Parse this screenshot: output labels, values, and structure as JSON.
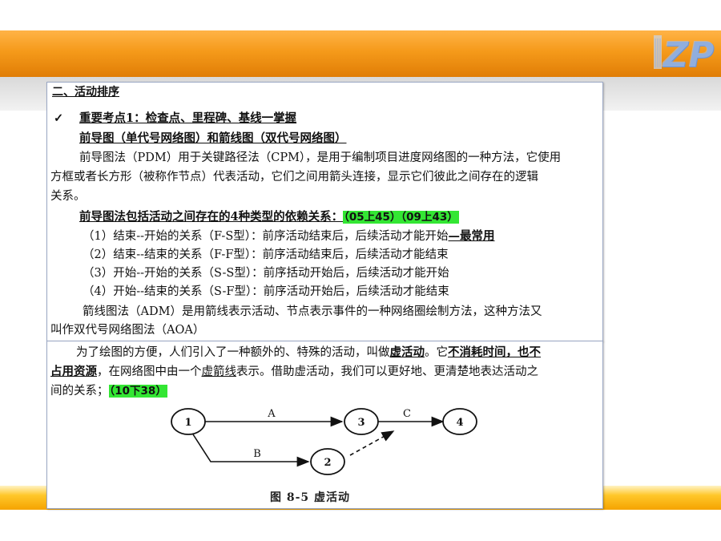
{
  "logo": {
    "text": "ZP"
  },
  "panel1": {
    "section_heading": "二、活动排序",
    "check": "✓",
    "key_point": "重要考点1：检查点、里程碑、基线一掌握",
    "subheading": "前导图（单代号网络图）和箭线图（双代号网络图）",
    "para1_l1": "前导图法（PDM）用于关键路径法（CPM），是用于编制项目进度网络图的一种方法，它使用",
    "para1_l2": "方框或者长方形（被称作节点）代表活动，它们之间用箭头连接，显示它们彼此之间存在的逻辑",
    "para1_l3": "关系。",
    "dep_heading": "前导图法包括活动之间存在的4种类型的依赖关系：",
    "dep_ref": "（05上45）（09上43）",
    "item1": "（1）结束--开始的关系（F-S型）：前序活动结束后，后续活动才能开始",
    "item1_note": "—最常用",
    "item2": "（2）结束--结束的关系（F-F型）：前序活动结束后，后续活动才能结束",
    "item3": "（3）开始--开始的关系（S-S型）：前序括动开始后，后续活动才能开始",
    "item4": "（4）开始--结束的关系（S-F型）：前序活动开始后，后续活动才能结束",
    "para2_l1": "箭线图法（ADM）是用箭线表示活动、节点表示事件的一种网络圈绘制方法，这种方法又",
    "para2_l2": "叫作双代号网络图法（AOA）"
  },
  "panel2": {
    "l1_a": "为了绘图的方便，人们引入了一种额外的、特殊的活动，叫做",
    "l1_b": "虚活动",
    "l1_c": "。它",
    "l1_d": "不消耗时间，也不",
    "l2_a": "占用资源",
    "l2_b": "，在网络图中由一个",
    "l2_c": "虚箭线",
    "l2_d": "表示。借助虚活动，我们可以更好地、更清楚地表达活动之",
    "l3_a": "间的关系；",
    "l3_ref": "（10下38）",
    "diagram": {
      "nodes": [
        "1",
        "2",
        "3",
        "4"
      ],
      "edges": [
        {
          "from": "1",
          "to": "3",
          "label": "A"
        },
        {
          "from": "3",
          "to": "4",
          "label": "C"
        },
        {
          "from": "1",
          "to": "2",
          "label": "B"
        },
        {
          "from": "2",
          "to": "3",
          "label": "",
          "dummy": true
        }
      ],
      "caption": "图 8-5    虚活动"
    }
  }
}
